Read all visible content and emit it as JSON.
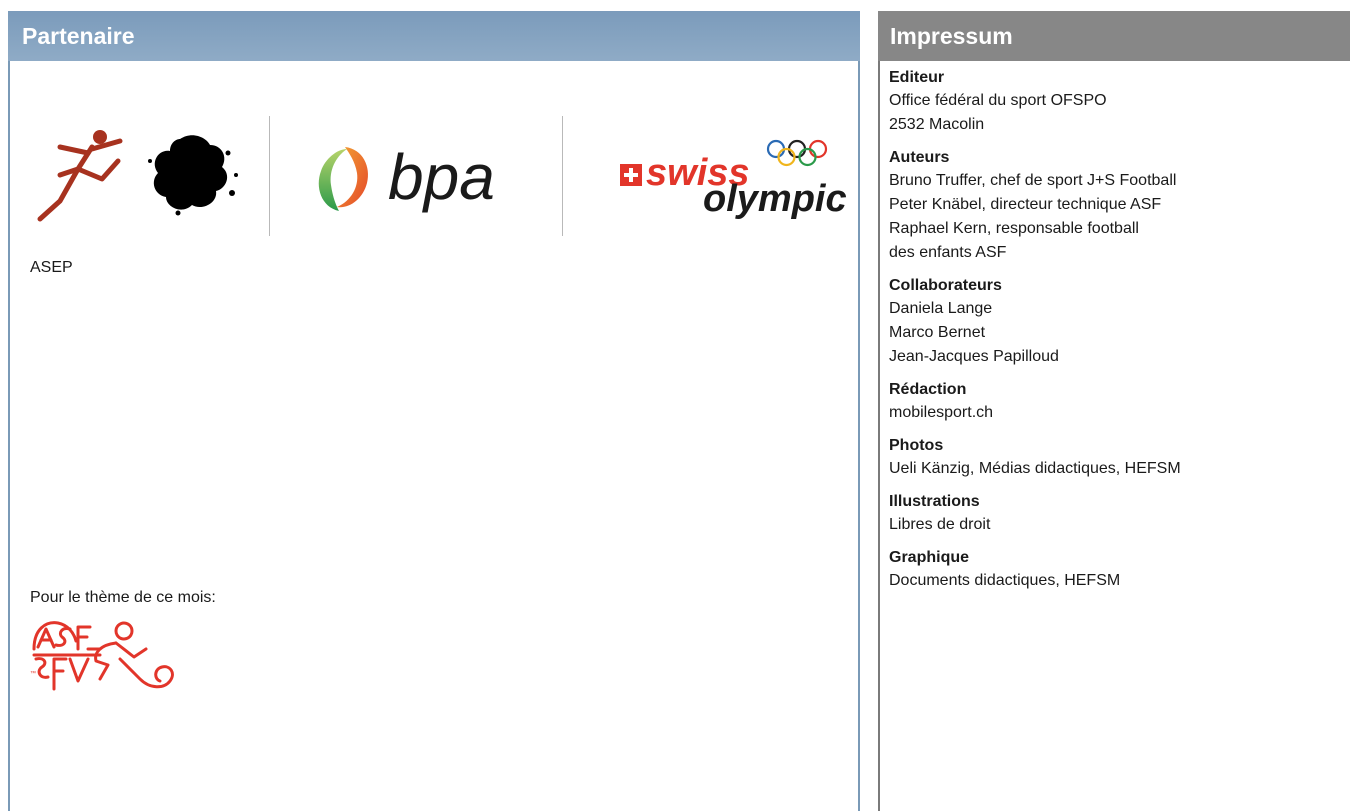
{
  "partner": {
    "title": "Partenaire",
    "asep_label": "ASEP",
    "bpa_text": "bpa",
    "swiss_text": "swiss",
    "olympic_text": "olympic",
    "theme_label": "Pour le thème de ce mois:",
    "colors": {
      "header": "#7b9bbb",
      "asep": "#a7321f",
      "asf": "#e2352a"
    }
  },
  "impressum": {
    "title": "Impressum",
    "sections": [
      {
        "title": "Editeur",
        "lines": [
          "Office fédéral du sport OFSPO",
          "2532 Macolin"
        ]
      },
      {
        "title": "Auteurs",
        "lines": [
          "Bruno Truffer, chef de sport J+S Football",
          "Peter Knäbel, directeur technique ASF",
          "Raphael Kern, responsable football",
          "des enfants ASF"
        ]
      },
      {
        "title": "Collaborateurs",
        "lines": [
          "Daniela Lange",
          "Marco Bernet",
          "Jean-Jacques Papilloud"
        ]
      },
      {
        "title": "Rédaction",
        "lines": [
          "mobilesport.ch"
        ]
      },
      {
        "title": "Photos",
        "lines": [
          "Ueli Känzig, Médias didactiques, HEFSM"
        ]
      },
      {
        "title": "Illustrations",
        "lines": [
          "Libres de droit"
        ]
      },
      {
        "title": "Graphique",
        "lines": [
          "Documents didactiques, HEFSM"
        ]
      }
    ]
  }
}
